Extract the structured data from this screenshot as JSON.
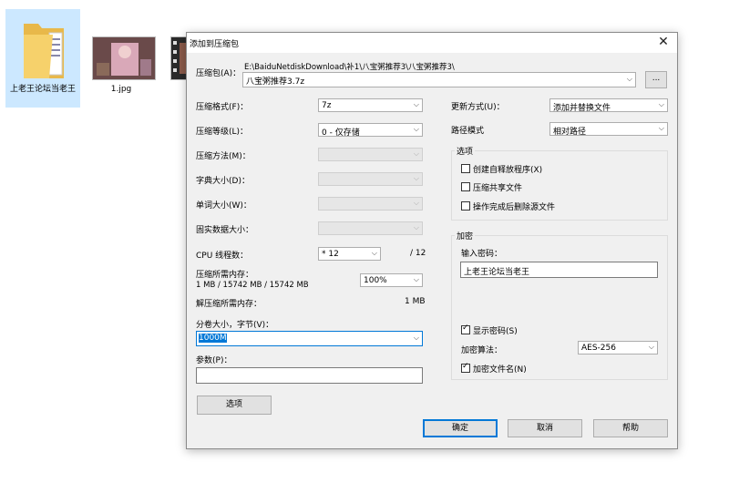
{
  "desktop": {
    "files": [
      {
        "label": "上老王论坛当老王"
      },
      {
        "label": "1.jpg"
      },
      {
        "label": ""
      }
    ]
  },
  "dialog": {
    "title": "添加到压缩包",
    "archive": {
      "label": "压缩包(A)：",
      "path": "E:\\BaiduNetdiskDownload\\补1\\八宝粥推荐3\\八宝粥推荐3\\",
      "name": "八宝粥推荐3.7z",
      "browse_label": "..."
    },
    "left": {
      "format": {
        "label": "压缩格式(F)：",
        "value": "7z"
      },
      "level": {
        "label": "压缩等级(L)：",
        "value": "0 - 仅存储"
      },
      "method": {
        "label": "压缩方法(M)：",
        "value": ""
      },
      "dict": {
        "label": "字典大小(D)：",
        "value": ""
      },
      "word": {
        "label": "单词大小(W)：",
        "value": ""
      },
      "solid": {
        "label": "固实数据大小：",
        "value": ""
      },
      "cpu": {
        "label": "CPU 线程数：",
        "value": "* 12",
        "total": "/ 12"
      },
      "mem_compress": {
        "label": "压缩所需内存：",
        "detail": "1 MB / 15742 MB / 15742 MB",
        "percent": "100%"
      },
      "mem_decompress": {
        "label": "解压缩所需内存：",
        "value": "1 MB"
      },
      "volume": {
        "label": "分卷大小，字节(V)：",
        "value": "1000M"
      },
      "params": {
        "label": "参数(P)：",
        "value": ""
      },
      "options_button": "选项"
    },
    "right": {
      "update": {
        "label": "更新方式(U)：",
        "value": "添加并替换文件"
      },
      "path_mode": {
        "label": "路径模式",
        "value": "相对路径"
      },
      "options": {
        "title": "选项",
        "sfx": {
          "label": "创建自释放程序(X)",
          "checked": false
        },
        "shared": {
          "label": "压缩共享文件",
          "checked": false
        },
        "delete": {
          "label": "操作完成后删除源文件",
          "checked": false
        }
      },
      "encryption": {
        "title": "加密",
        "password_label": "输入密码：",
        "password_value": "上老王论坛当老王",
        "show_password": {
          "label": "显示密码(S)",
          "checked": true
        },
        "method_label": "加密算法：",
        "method_value": "AES-256",
        "encrypt_names": {
          "label": "加密文件名(N)",
          "checked": true
        }
      }
    },
    "buttons": {
      "ok": "确定",
      "cancel": "取消",
      "help": "帮助"
    }
  }
}
